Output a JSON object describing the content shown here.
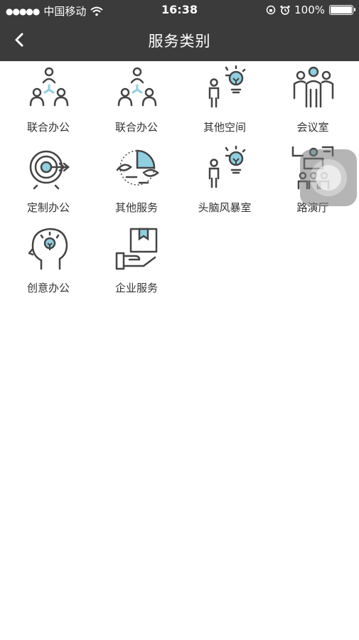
{
  "status_bar": {
    "signal_dots": "●●●●●",
    "carrier": "中国移动",
    "time": "16:38",
    "battery": "100%",
    "icons": [
      "wifi-icon",
      "rotation-lock-icon",
      "alarm-icon",
      "battery-icon"
    ]
  },
  "nav": {
    "title": "服务类别",
    "back_icon": "chevron-left-icon"
  },
  "categories": [
    {
      "label": "联合办公",
      "icon": "team-network-icon"
    },
    {
      "label": "联合办公",
      "icon": "team-network-icon"
    },
    {
      "label": "其他空间",
      "icon": "person-lightbulb-icon"
    },
    {
      "label": "会议室",
      "icon": "group-people-icon"
    },
    {
      "label": "定制办公",
      "icon": "target-arrow-icon"
    },
    {
      "label": "其他服务",
      "icon": "service-cycle-icon"
    },
    {
      "label": "头脑风暴室",
      "icon": "person-lightbulb-icon"
    },
    {
      "label": "路演厅",
      "icon": "presentation-hall-icon"
    },
    {
      "label": "创意办公",
      "icon": "head-idea-icon"
    },
    {
      "label": "企业服务",
      "icon": "hand-package-icon"
    }
  ],
  "colors": {
    "header_bg": "#3b3b3b",
    "icon_stroke": "#444444",
    "icon_accent": "#8ecfe0",
    "label_text": "#333333"
  }
}
